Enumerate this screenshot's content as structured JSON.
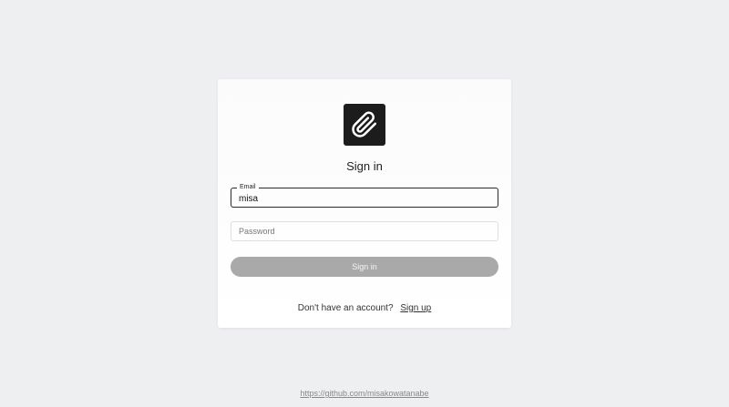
{
  "logo": {
    "icon": "paperclip-icon",
    "background": "#1c1c1c"
  },
  "title": "Sign in",
  "email_field": {
    "legend": "Email",
    "value": "misa"
  },
  "password_field": {
    "placeholder": "Password"
  },
  "signin_button": {
    "label": "Sign in",
    "color": "#a9a9a9"
  },
  "signup": {
    "prompt": "Don't have an account?",
    "link_label": "Sign up"
  },
  "footer": {
    "link": "https://github.com/misakowatanabe"
  }
}
